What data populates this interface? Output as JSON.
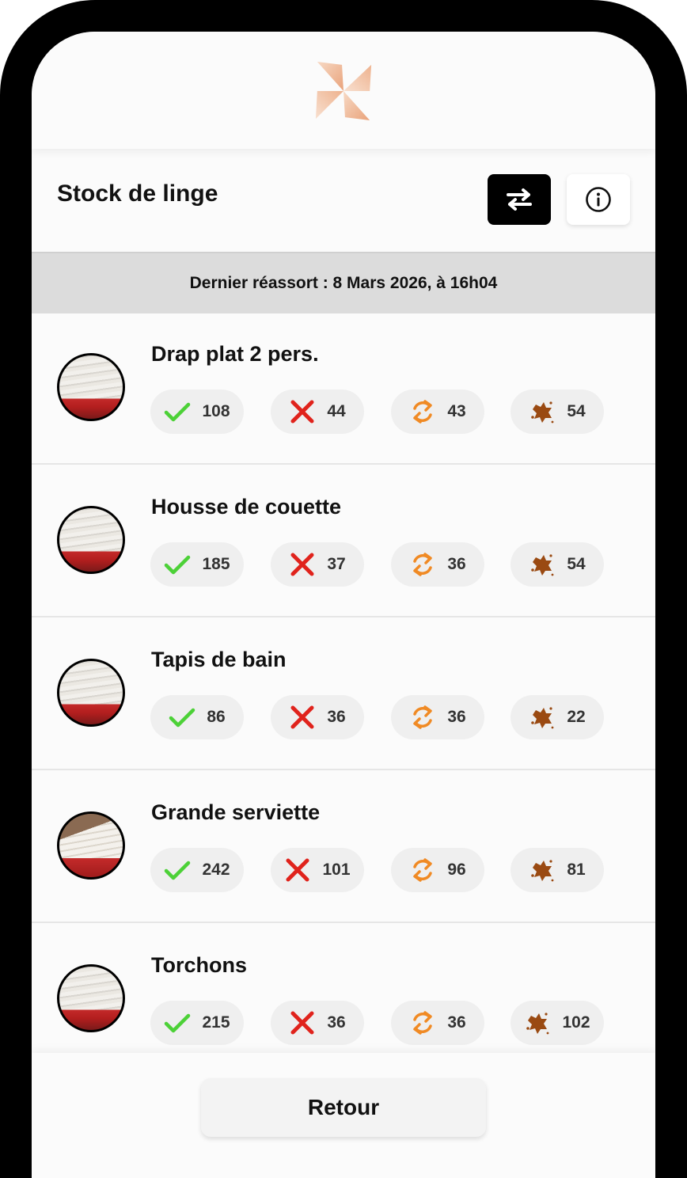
{
  "app": {
    "title": "Stock de linge",
    "restock_label": "Dernier réassort : 8 Mars 2026, à 16h04",
    "back_label": "Retour"
  },
  "icons": {
    "switch": "swap-arrows-icon",
    "info": "info-icon",
    "ok": "check-icon",
    "missing": "cross-icon",
    "rotation": "refresh-icon",
    "stained": "stain-icon"
  },
  "colors": {
    "ok": "#4cd137",
    "missing": "#e0231c",
    "rotation": "#f08a24",
    "stained": "#9a4a12"
  },
  "items": [
    {
      "name": "Drap plat 2 pers.",
      "ok": "108",
      "missing": "44",
      "rotation": "43",
      "stained": "54"
    },
    {
      "name": "Housse de couette",
      "ok": "185",
      "missing": "37",
      "rotation": "36",
      "stained": "54"
    },
    {
      "name": "Tapis de bain",
      "ok": "86",
      "missing": "36",
      "rotation": "36",
      "stained": "22"
    },
    {
      "name": "Grande serviette",
      "ok": "242",
      "missing": "101",
      "rotation": "96",
      "stained": "81"
    },
    {
      "name": "Torchons",
      "ok": "215",
      "missing": "36",
      "rotation": "36",
      "stained": "102"
    }
  ]
}
